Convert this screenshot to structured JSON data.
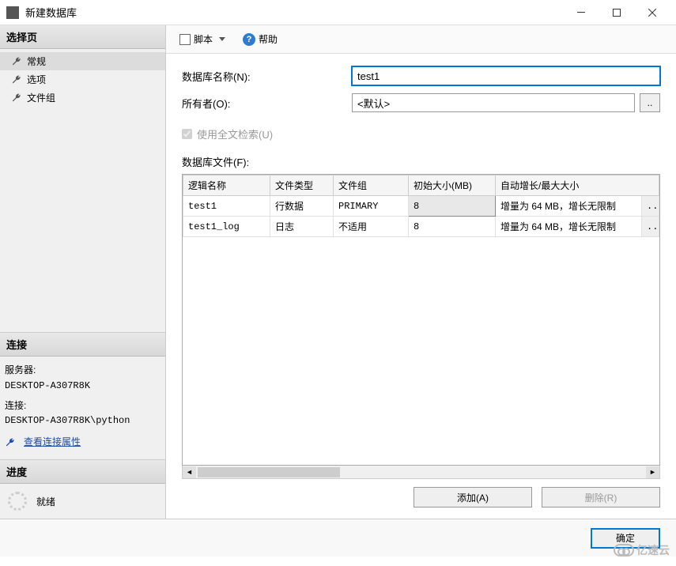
{
  "window": {
    "title": "新建数据库"
  },
  "sidebar": {
    "select_header": "选择页",
    "items": [
      "常规",
      "选项",
      "文件组"
    ],
    "connection_header": "连接",
    "server_label": "服务器:",
    "server_value": "DESKTOP-A307R8K",
    "conn_label": "连接:",
    "conn_value": "DESKTOP-A307R8K\\python",
    "view_props": "查看连接属性",
    "progress_header": "进度",
    "progress_status": "就绪"
  },
  "toolbar": {
    "script": "脚本",
    "help": "帮助"
  },
  "form": {
    "dbname_label": "数据库名称(N):",
    "dbname_value": "test1",
    "owner_label": "所有者(O):",
    "owner_value": "<默认>",
    "fulltext_label": "使用全文检索(U)",
    "files_label": "数据库文件(F):"
  },
  "grid": {
    "headers": [
      "逻辑名称",
      "文件类型",
      "文件组",
      "初始大小(MB)",
      "自动增长/最大大小"
    ],
    "rows": [
      {
        "name": "test1",
        "type": "行数据",
        "group": "PRIMARY",
        "size": "8",
        "growth": "增量为 64 MB，增长无限制"
      },
      {
        "name": "test1_log",
        "type": "日志",
        "group": "不适用",
        "size": "8",
        "growth": "增量为 64 MB，增长无限制"
      }
    ]
  },
  "actions": {
    "add": "添加(A)",
    "remove": "删除(R)"
  },
  "footer": {
    "ok": "确定"
  },
  "watermark": "亿速云"
}
